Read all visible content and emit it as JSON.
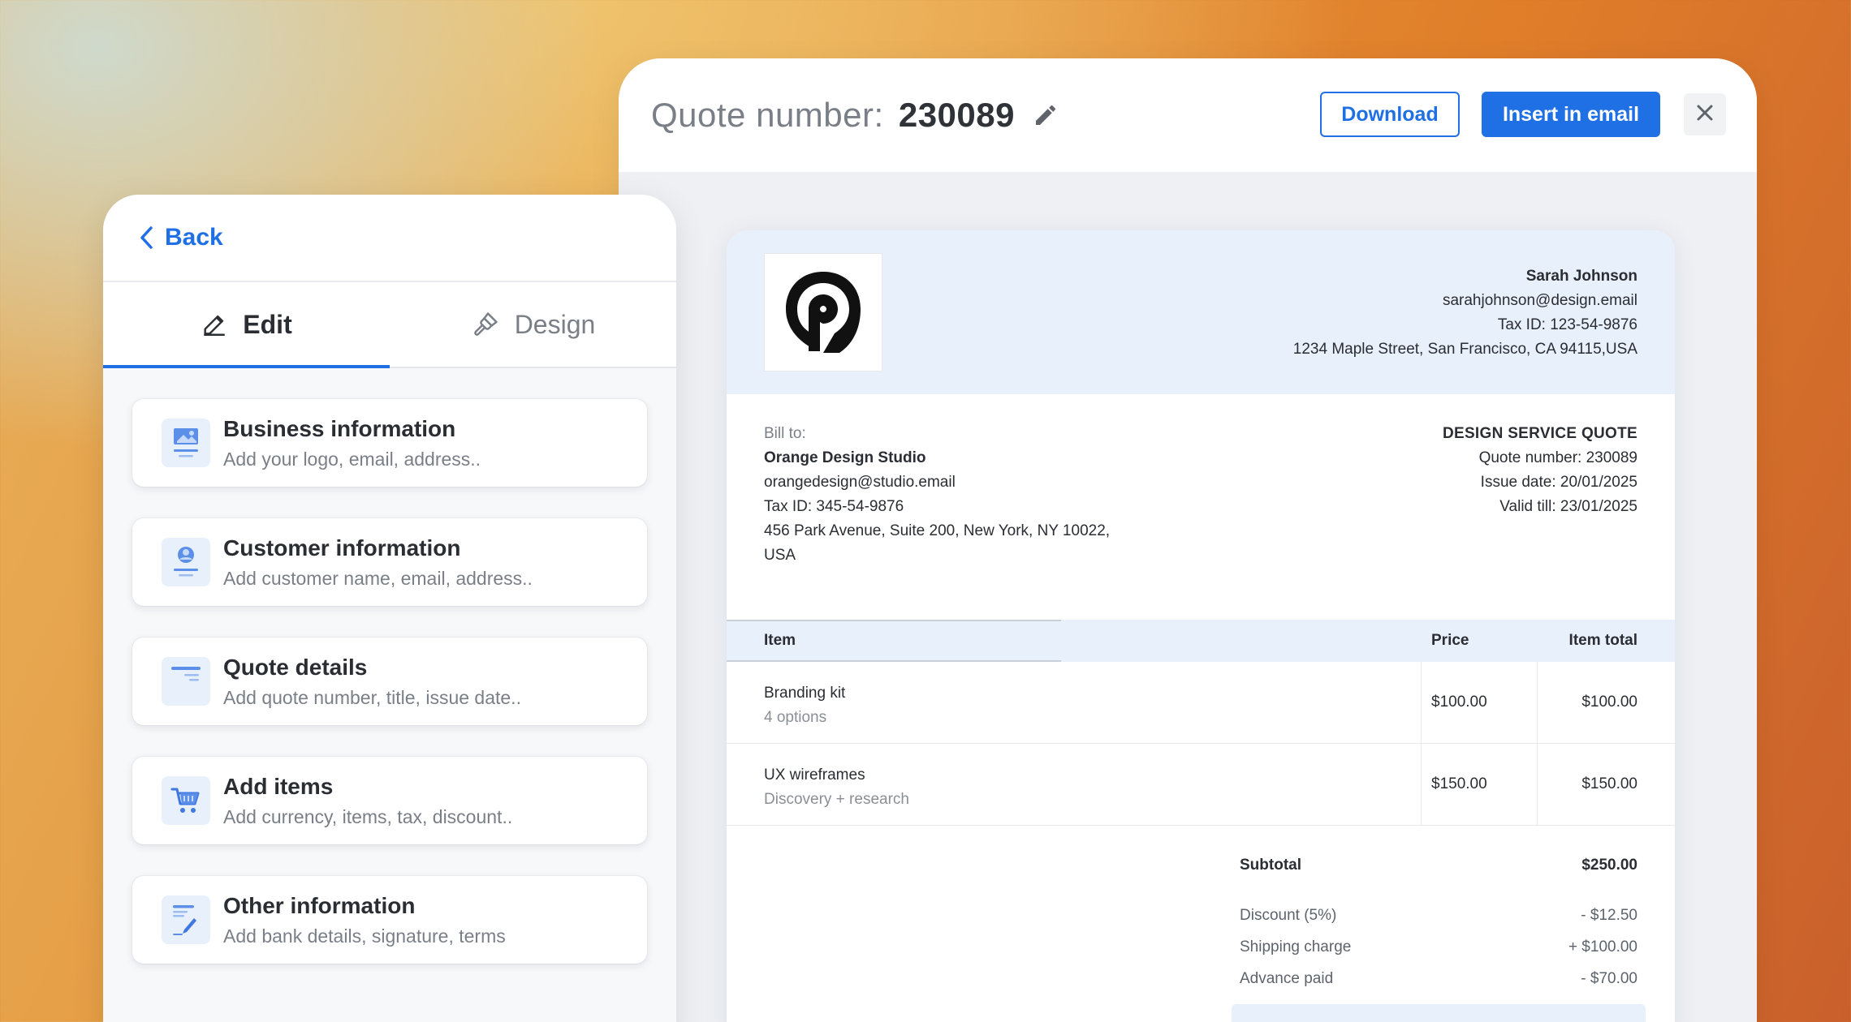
{
  "colors": {
    "accent": "#1f6fe5",
    "doc_tint": "#e8f0fc"
  },
  "quote_header": {
    "title_label": "Quote number:",
    "title_number": "230089",
    "download_label": "Download",
    "insert_label": "Insert in email"
  },
  "document": {
    "seller": {
      "name": "Sarah Johnson",
      "email": "sarahjohnson@design.email",
      "tax_id": "Tax ID: 123-54-9876",
      "address": "1234 Maple Street, San Francisco, CA 94115,USA"
    },
    "bill_to": {
      "label": "Bill to:",
      "name": "Orange Design Studio",
      "email": "orangedesign@studio.email",
      "tax_id": "Tax ID: 345-54-9876",
      "address_line1": "456 Park Avenue, Suite 200, New York, NY 10022,",
      "address_line2": "USA"
    },
    "meta": {
      "title": "DESIGN SERVICE QUOTE",
      "quote_number": "Quote number: 230089",
      "issue_date": "Issue date: 20/01/2025",
      "valid_till": "Valid till: 23/01/2025"
    },
    "table": {
      "headers": {
        "item": "Item",
        "price": "Price",
        "total": "Item total"
      },
      "rows": [
        {
          "name": "Branding kit",
          "sub": "4 options",
          "price": "$100.00",
          "total": "$100.00"
        },
        {
          "name": "UX wireframes",
          "sub": "Discovery + research",
          "price": "$150.00",
          "total": "$150.00"
        }
      ]
    },
    "summary": {
      "subtotal_label": "Subtotal",
      "subtotal_value": "$250.00",
      "discount_label": "Discount (5%)",
      "discount_value": "- $12.50",
      "shipping_label": "Shipping charge",
      "shipping_value": "+ $100.00",
      "advance_label": "Advance paid",
      "advance_value": "- $70.00"
    }
  },
  "edit_panel": {
    "back_label": "Back",
    "tabs": {
      "edit": "Edit",
      "design": "Design"
    },
    "cards": [
      {
        "title": "Business information",
        "subtitle": "Add your logo, email, address..",
        "icon": "image-card-icon"
      },
      {
        "title": "Customer information",
        "subtitle": "Add customer name, email, address..",
        "icon": "user-card-icon"
      },
      {
        "title": "Quote details",
        "subtitle": "Add quote number, title, issue date..",
        "icon": "document-icon"
      },
      {
        "title": "Add items",
        "subtitle": "Add currency, items, tax, discount..",
        "icon": "cart-icon"
      },
      {
        "title": "Other information",
        "subtitle": "Add bank details, signature, terms",
        "icon": "signature-icon"
      }
    ]
  }
}
